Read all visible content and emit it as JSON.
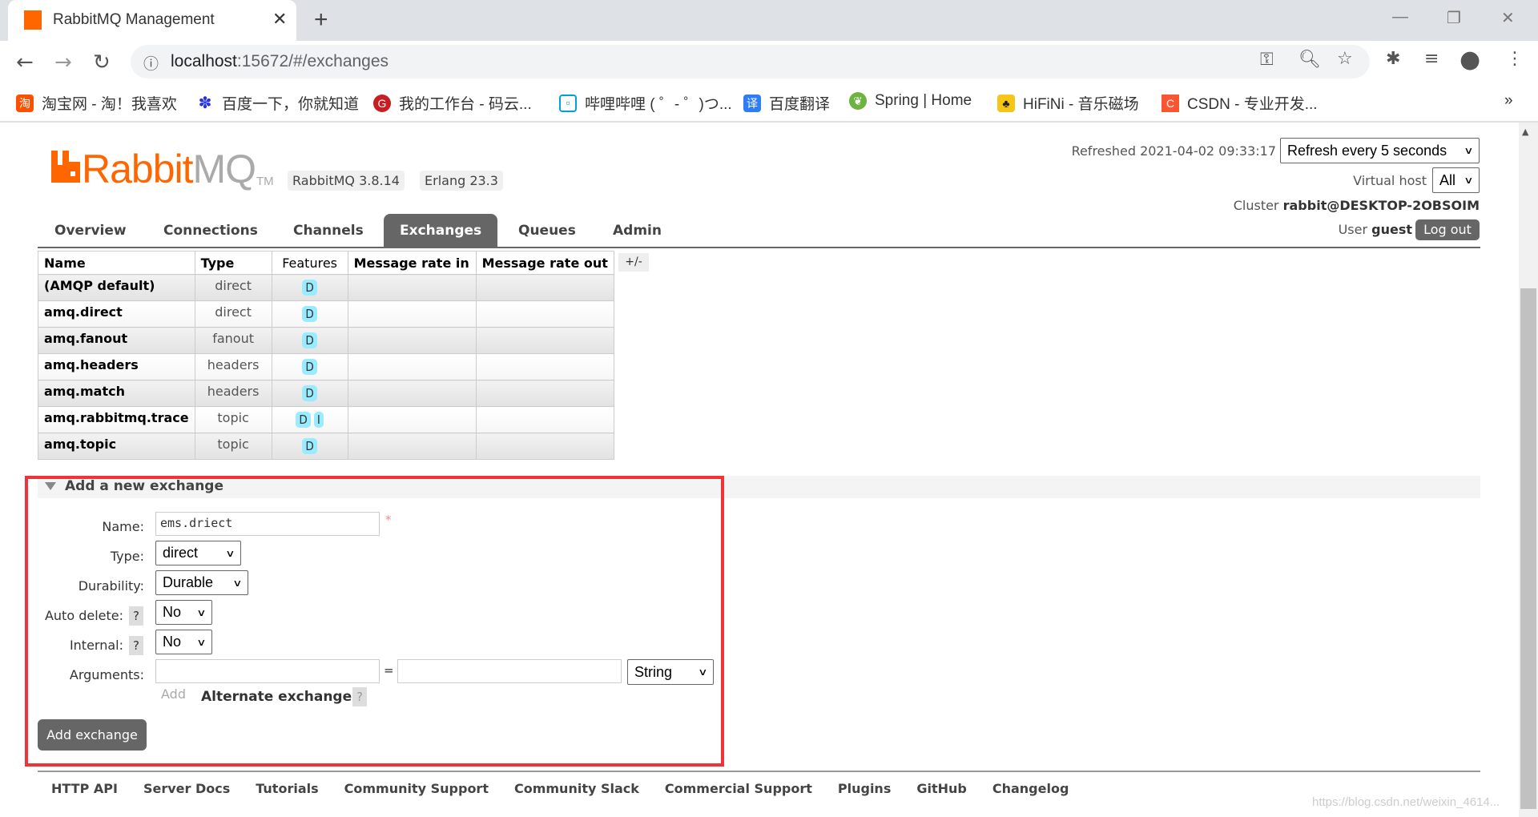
{
  "browser": {
    "tab_title": "RabbitMQ Management",
    "url_host": "localhost",
    "url_path": ":15672/#/exchanges",
    "bookmarks": [
      {
        "label": "淘宝网 - 淘！我喜欢",
        "icon": "taobao-icon",
        "color": "#ff5000"
      },
      {
        "label": "百度一下，你就知道",
        "icon": "baidu-paw-icon",
        "color": "#2932e1"
      },
      {
        "label": "我的工作台 - 码云...",
        "icon": "gitee-icon",
        "color": "#c71d23"
      },
      {
        "label": "哔哩哔哩 ( ゜- ゜)つ...",
        "icon": "bilibili-icon",
        "color": "#00a1d6"
      },
      {
        "label": "百度翻译",
        "icon": "translate-icon",
        "color": "#2e7cf6"
      },
      {
        "label": "Spring | Home",
        "icon": "spring-icon",
        "color": "#6db33f"
      },
      {
        "label": "HiFiNi - 音乐磁场",
        "icon": "hifini-icon",
        "color": "#f5c518"
      },
      {
        "label": "CSDN - 专业开发...",
        "icon": "csdn-icon",
        "color": "#fc5531"
      }
    ],
    "more_bookmarks": "»"
  },
  "header": {
    "logo_text_a": "Rabbit",
    "logo_text_b": "MQ",
    "logo_tm": "TM",
    "version": "RabbitMQ 3.8.14",
    "erlang": "Erlang 23.3",
    "refreshed": "Refreshed 2021-04-02 09:33:17",
    "refresh_select": "Refresh every 5 seconds",
    "vhost_label": "Virtual host",
    "vhost_value": "All",
    "cluster_label": "Cluster",
    "cluster_value": "rabbit@DESKTOP-2OBSOIM",
    "user_label": "User",
    "user_value": "guest",
    "logout": "Log out"
  },
  "nav": [
    "Overview",
    "Connections",
    "Channels",
    "Exchanges",
    "Queues",
    "Admin"
  ],
  "nav_active": "Exchanges",
  "table": {
    "columns": [
      "Name",
      "Type",
      "Features",
      "Message rate in",
      "Message rate out"
    ],
    "toggle": "+/-",
    "rows": [
      {
        "name": "(AMQP default)",
        "type": "direct",
        "features": [
          "D"
        ]
      },
      {
        "name": "amq.direct",
        "type": "direct",
        "features": [
          "D"
        ]
      },
      {
        "name": "amq.fanout",
        "type": "fanout",
        "features": [
          "D"
        ]
      },
      {
        "name": "amq.headers",
        "type": "headers",
        "features": [
          "D"
        ]
      },
      {
        "name": "amq.match",
        "type": "headers",
        "features": [
          "D"
        ]
      },
      {
        "name": "amq.rabbitmq.trace",
        "type": "topic",
        "features": [
          "D",
          "I"
        ]
      },
      {
        "name": "amq.topic",
        "type": "topic",
        "features": [
          "D"
        ]
      }
    ]
  },
  "form": {
    "section_title": "Add a new exchange",
    "name_label": "Name:",
    "name_value": "ems.driect",
    "required_mark": "*",
    "type_label": "Type:",
    "type_value": "direct",
    "durability_label": "Durability:",
    "durability_value": "Durable",
    "auto_delete_label": "Auto delete:",
    "auto_delete_value": "No",
    "internal_label": "Internal:",
    "internal_value": "No",
    "arguments_label": "Arguments:",
    "equals": "=",
    "arg_type_value": "String",
    "add_link": "Add",
    "alternate_exchange": "Alternate exchange",
    "help": "?",
    "submit": "Add exchange",
    "highlight_color": "#ee3438"
  },
  "footer": [
    "HTTP API",
    "Server Docs",
    "Tutorials",
    "Community Support",
    "Community Slack",
    "Commercial Support",
    "Plugins",
    "GitHub",
    "Changelog"
  ],
  "watermark": "https://blog.csdn.net/weixin_4614..."
}
